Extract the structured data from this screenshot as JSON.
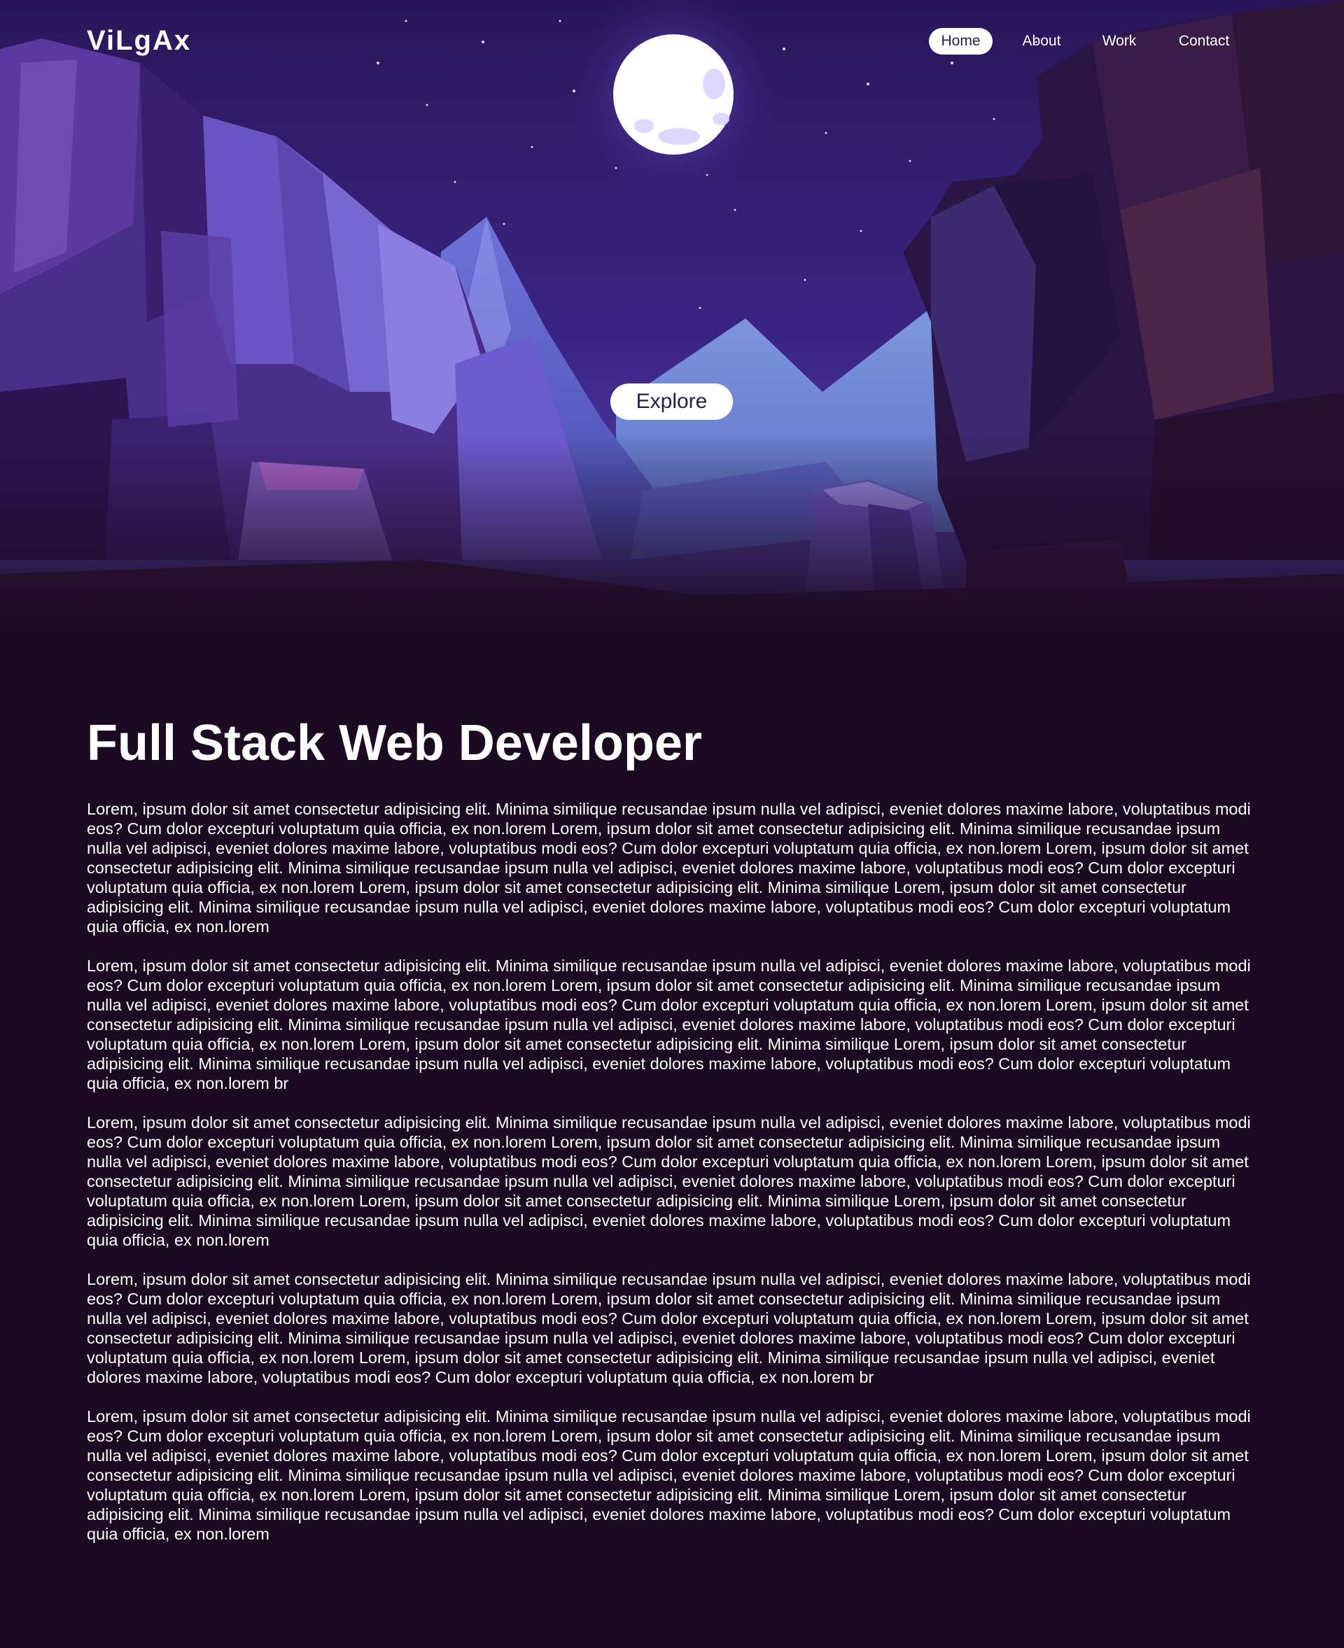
{
  "brand": {
    "logo_text": "ViLgAx"
  },
  "nav": {
    "items": [
      {
        "label": "Home",
        "active": true
      },
      {
        "label": "About",
        "active": false
      },
      {
        "label": "Work",
        "active": false
      },
      {
        "label": "Contact",
        "active": false
      }
    ]
  },
  "hero": {
    "explore_label": "Explore",
    "illustration": "night canyon landscape with full moon",
    "colors": {
      "sky_top": "#2a1659",
      "sky_glow": "#6a4fd0",
      "moon": "#ffffff",
      "rock_light": "#7a64d6",
      "rock_dark": "#2a1644",
      "background": "#1c0922"
    }
  },
  "content": {
    "headline": "Full Stack Web Developer",
    "paragraphs": [
      "Lorem, ipsum dolor sit amet consectetur adipisicing elit. Minima similique recusandae ipsum nulla vel adipisci, eveniet dolores maxime labore, voluptatibus modi eos? Cum dolor excepturi voluptatum quia officia, ex non.lorem Lorem, ipsum dolor sit amet consectetur adipisicing elit. Minima similique recusandae ipsum nulla vel adipisci, eveniet dolores maxime labore, voluptatibus modi eos? Cum dolor excepturi voluptatum quia officia, ex non.lorem Lorem, ipsum dolor sit amet consectetur adipisicing elit. Minima similique recusandae ipsum nulla vel adipisci, eveniet dolores maxime labore, voluptatibus modi eos? Cum dolor excepturi voluptatum quia officia, ex non.lorem Lorem, ipsum dolor sit amet consectetur adipisicing elit. Minima similique Lorem, ipsum dolor sit amet consectetur adipisicing elit. Minima similique recusandae ipsum nulla vel adipisci, eveniet dolores maxime labore, voluptatibus modi eos? Cum dolor excepturi voluptatum quia officia, ex non.lorem",
      "Lorem, ipsum dolor sit amet consectetur adipisicing elit. Minima similique recusandae ipsum nulla vel adipisci, eveniet dolores maxime labore, voluptatibus modi eos? Cum dolor excepturi voluptatum quia officia, ex non.lorem Lorem, ipsum dolor sit amet consectetur adipisicing elit. Minima similique recusandae ipsum nulla vel adipisci, eveniet dolores maxime labore, voluptatibus modi eos? Cum dolor excepturi voluptatum quia officia, ex non.lorem Lorem, ipsum dolor sit amet consectetur adipisicing elit. Minima similique recusandae ipsum nulla vel adipisci, eveniet dolores maxime labore, voluptatibus modi eos? Cum dolor excepturi voluptatum quia officia, ex non.lorem Lorem, ipsum dolor sit amet consectetur adipisicing elit. Minima similique Lorem, ipsum dolor sit amet consectetur adipisicing elit. Minima similique recusandae ipsum nulla vel adipisci, eveniet dolores maxime labore, voluptatibus modi eos? Cum dolor excepturi voluptatum quia officia, ex non.lorem br",
      "Lorem, ipsum dolor sit amet consectetur adipisicing elit. Minima similique recusandae ipsum nulla vel adipisci, eveniet dolores maxime labore, voluptatibus modi eos? Cum dolor excepturi voluptatum quia officia, ex non.lorem Lorem, ipsum dolor sit amet consectetur adipisicing elit. Minima similique recusandae ipsum nulla vel adipisci, eveniet dolores maxime labore, voluptatibus modi eos? Cum dolor excepturi voluptatum quia officia, ex non.lorem Lorem, ipsum dolor sit amet consectetur adipisicing elit. Minima similique recusandae ipsum nulla vel adipisci, eveniet dolores maxime labore, voluptatibus modi eos? Cum dolor excepturi voluptatum quia officia, ex non.lorem Lorem, ipsum dolor sit amet consectetur adipisicing elit. Minima similique Lorem, ipsum dolor sit amet consectetur adipisicing elit. Minima similique recusandae ipsum nulla vel adipisci, eveniet dolores maxime labore, voluptatibus modi eos? Cum dolor excepturi voluptatum quia officia, ex non.lorem",
      "Lorem, ipsum dolor sit amet consectetur adipisicing elit. Minima similique recusandae ipsum nulla vel adipisci, eveniet dolores maxime labore, voluptatibus modi eos? Cum dolor excepturi voluptatum quia officia, ex non.lorem Lorem, ipsum dolor sit amet consectetur adipisicing elit. Minima similique recusandae ipsum nulla vel adipisci, eveniet dolores maxime labore, voluptatibus modi eos? Cum dolor excepturi voluptatum quia officia, ex non.lorem Lorem, ipsum dolor sit amet consectetur adipisicing elit. Minima similique recusandae ipsum nulla vel adipisci, eveniet dolores maxime labore, voluptatibus modi eos? Cum dolor excepturi voluptatum quia officia, ex non.lorem Lorem, ipsum dolor sit amet consectetur adipisicing elit. Minima similique recusandae ipsum nulla vel adipisci, eveniet dolores maxime labore, voluptatibus modi eos? Cum dolor excepturi voluptatum quia officia, ex non.lorem br",
      "Lorem, ipsum dolor sit amet consectetur adipisicing elit. Minima similique recusandae ipsum nulla vel adipisci, eveniet dolores maxime labore, voluptatibus modi eos? Cum dolor excepturi voluptatum quia officia, ex non.lorem Lorem, ipsum dolor sit amet consectetur adipisicing elit. Minima similique recusandae ipsum nulla vel adipisci, eveniet dolores maxime labore, voluptatibus modi eos? Cum dolor excepturi voluptatum quia officia, ex non.lorem Lorem, ipsum dolor sit amet consectetur adipisicing elit. Minima similique recusandae ipsum nulla vel adipisci, eveniet dolores maxime labore, voluptatibus modi eos? Cum dolor excepturi voluptatum quia officia, ex non.lorem Lorem, ipsum dolor sit amet consectetur adipisicing elit. Minima similique Lorem, ipsum dolor sit amet consectetur adipisicing elit. Minima similique recusandae ipsum nulla vel adipisci, eveniet dolores maxime labore, voluptatibus modi eos? Cum dolor excepturi voluptatum quia officia, ex non.lorem"
    ]
  }
}
